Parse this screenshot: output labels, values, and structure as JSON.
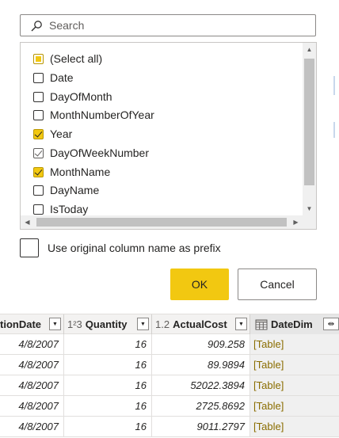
{
  "search": {
    "placeholder": "Search"
  },
  "list": {
    "items": [
      {
        "label": "(Select all)",
        "state": "partial"
      },
      {
        "label": "Date",
        "state": "unchecked"
      },
      {
        "label": "DayOfMonth",
        "state": "unchecked"
      },
      {
        "label": "MonthNumberOfYear",
        "state": "unchecked"
      },
      {
        "label": "Year",
        "state": "checked"
      },
      {
        "label": "DayOfWeekNumber",
        "state": "checked-gray"
      },
      {
        "label": "MonthName",
        "state": "checked"
      },
      {
        "label": "DayName",
        "state": "unchecked"
      },
      {
        "label": "IsToday",
        "state": "unchecked"
      }
    ]
  },
  "prefix": {
    "label": "Use original column name as prefix"
  },
  "buttons": {
    "ok": "OK",
    "cancel": "Cancel"
  },
  "grid": {
    "columns": [
      {
        "type": "",
        "name": "tionDate"
      },
      {
        "type": "1²3",
        "name": "Quantity"
      },
      {
        "type": "1.2",
        "name": "ActualCost"
      },
      {
        "type": "",
        "name": "DateDim"
      }
    ],
    "rows": [
      [
        "4/8/2007",
        "16",
        "909.258",
        "[Table]"
      ],
      [
        "4/8/2007",
        "16",
        "89.9894",
        "[Table]"
      ],
      [
        "4/8/2007",
        "16",
        "52022.3894",
        "[Table]"
      ],
      [
        "4/8/2007",
        "16",
        "2725.8692",
        "[Table]"
      ],
      [
        "4/8/2007",
        "16",
        "9011.2797",
        "[Table]"
      ]
    ]
  },
  "colors": {
    "accent": "#f2c811",
    "table_link": "#8a6d00"
  },
  "icons": {
    "search": "search-icon",
    "table": "table-icon",
    "expand": "expand-column-icon"
  }
}
